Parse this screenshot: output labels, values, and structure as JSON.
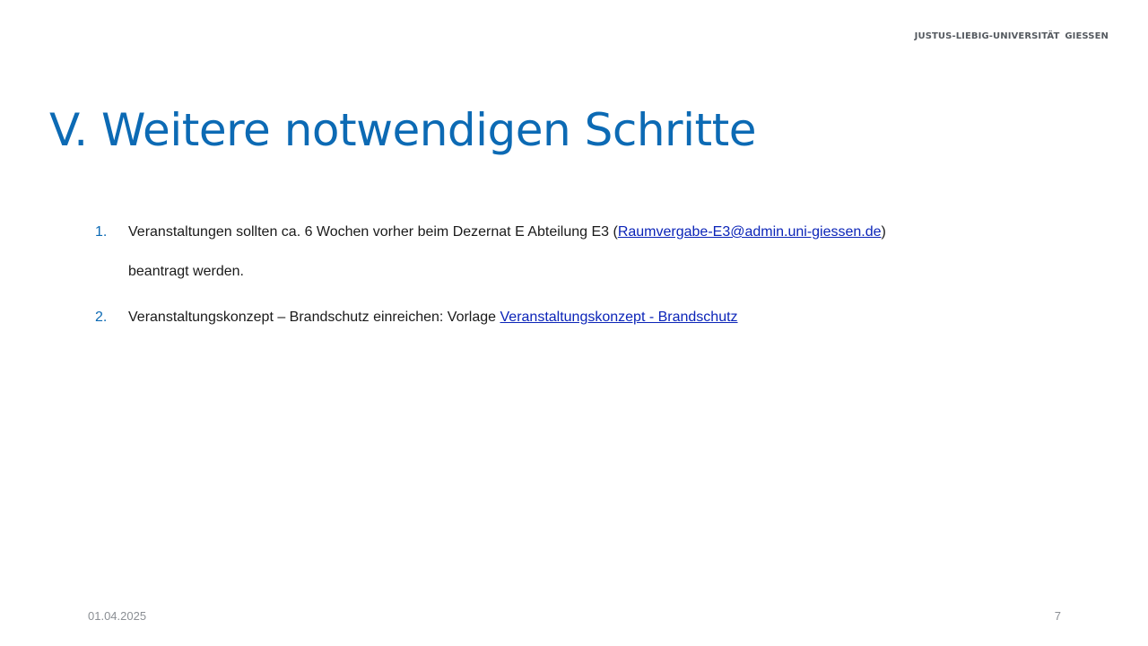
{
  "header": {
    "university": "JUSTUS-LIEBIG-UNIVERSITÄT",
    "city": "GIESSEN"
  },
  "title": "V. Weitere notwendigen Schritte",
  "steps": [
    {
      "number": "1.",
      "text_before": "Veranstaltungen sollten ca. 6 Wochen vorher beim Dezernat E Abteilung E3 (",
      "link_text": "Raumvergabe-E3@admin.uni-giessen.de",
      "text_after": ")",
      "continuation": "beantragt werden."
    },
    {
      "number": "2.",
      "text_before": "Veranstaltungskonzept – Brandschutz einreichen: Vorlage ",
      "link_text": "Veranstaltungskonzept - Brandschutz "
    }
  ],
  "footer": {
    "date": "01.04.2025",
    "page_number": "7"
  },
  "colors": {
    "title": "#0c6ab4",
    "link": "#0b24b8",
    "footer": "#8b8f94"
  }
}
